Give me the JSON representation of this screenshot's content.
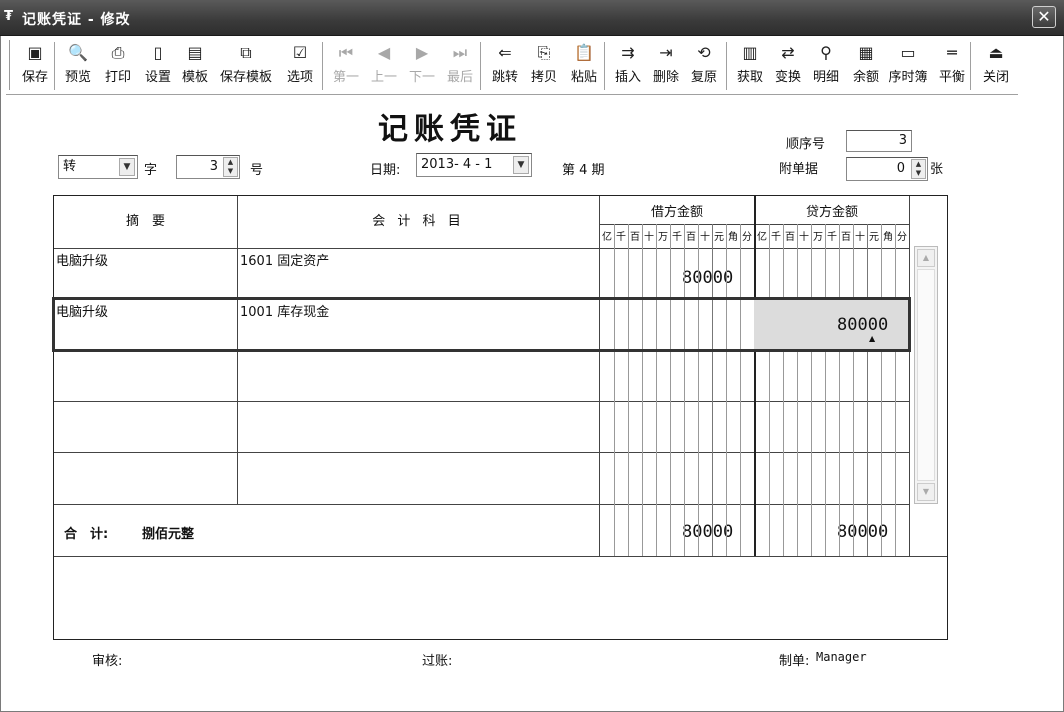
{
  "window": {
    "title": "记账凭证 - 修改",
    "close": "✕"
  },
  "toolbar": [
    {
      "label": "保存",
      "icon": "save-icon",
      "glyph": "▣",
      "enabled": true
    },
    {
      "label": "预览",
      "icon": "preview-icon",
      "glyph": "🔍",
      "enabled": true
    },
    {
      "label": "打印",
      "icon": "print-icon",
      "glyph": "⎙",
      "enabled": true
    },
    {
      "label": "设置",
      "icon": "page-setup-icon",
      "glyph": "▯",
      "enabled": true
    },
    {
      "label": "模板",
      "icon": "template-icon",
      "glyph": "▤",
      "enabled": true
    },
    {
      "label": "保存模板",
      "icon": "save-template-icon",
      "glyph": "⧉",
      "enabled": true
    },
    {
      "label": "选项",
      "icon": "options-icon",
      "glyph": "☑",
      "enabled": true
    },
    {
      "label": "第一",
      "icon": "first-icon",
      "glyph": "⏮",
      "enabled": false
    },
    {
      "label": "上一",
      "icon": "previous-icon",
      "glyph": "◀",
      "enabled": false
    },
    {
      "label": "下一",
      "icon": "next-icon",
      "glyph": "▶",
      "enabled": false
    },
    {
      "label": "最后",
      "icon": "last-icon",
      "glyph": "⏭",
      "enabled": false
    },
    {
      "label": "跳转",
      "icon": "jump-icon",
      "glyph": "⇐",
      "enabled": true
    },
    {
      "label": "拷贝",
      "icon": "copy-icon",
      "glyph": "⎘",
      "enabled": true
    },
    {
      "label": "粘贴",
      "icon": "paste-icon",
      "glyph": "📋",
      "enabled": true
    },
    {
      "label": "插入",
      "icon": "insert-row-icon",
      "glyph": "⇉",
      "enabled": true
    },
    {
      "label": "删除",
      "icon": "delete-row-icon",
      "glyph": "⇥",
      "enabled": true
    },
    {
      "label": "复原",
      "icon": "restore-icon",
      "glyph": "⟲",
      "enabled": true
    },
    {
      "label": "获取",
      "icon": "fetch-icon",
      "glyph": "▥",
      "enabled": true
    },
    {
      "label": "变换",
      "icon": "transform-icon",
      "glyph": "⇄",
      "enabled": true
    },
    {
      "label": "明细",
      "icon": "detail-icon",
      "glyph": "⚲",
      "enabled": true
    },
    {
      "label": "余额",
      "icon": "balance-icon",
      "glyph": "▦",
      "enabled": true
    },
    {
      "label": "序时簿",
      "icon": "journal-icon",
      "glyph": "▭",
      "enabled": true
    },
    {
      "label": "平衡",
      "icon": "balance-check-icon",
      "glyph": "═",
      "enabled": true
    },
    {
      "label": "关闭",
      "icon": "close-window-icon",
      "glyph": "⏏",
      "enabled": true
    }
  ],
  "voucher": {
    "title": "记账凭证",
    "seq_label": "顺序号",
    "seq_value": "3",
    "attach_label": "附单据",
    "attach_value": "0",
    "attach_unit": "张",
    "type_value": "转",
    "type_suffix": "字",
    "number_value": "3",
    "number_suffix": "号",
    "date_label": "日期:",
    "date_value": "2013- 4 - 1",
    "period": "第 4 期"
  },
  "table": {
    "headers": {
      "summary": "摘　要",
      "account": "会 计 科 目",
      "debit": "借方金额",
      "credit": "贷方金额"
    },
    "digit_units": [
      "亿",
      "千",
      "百",
      "十",
      "万",
      "千",
      "百",
      "十",
      "元",
      "角",
      "分"
    ],
    "rows": [
      {
        "summary": "电脑升级",
        "account": "1601 固定资产",
        "debit": "80000",
        "credit": ""
      },
      {
        "summary": "电脑升级",
        "account": "1001 库存现金",
        "debit": "",
        "credit": "80000"
      },
      {
        "summary": "",
        "account": "",
        "debit": "",
        "credit": ""
      },
      {
        "summary": "",
        "account": "",
        "debit": "",
        "credit": ""
      },
      {
        "summary": "",
        "account": "",
        "debit": "",
        "credit": ""
      }
    ],
    "total_label": "合　计:",
    "total_words": "捌佰元整",
    "total_debit": "80000",
    "total_credit": "80000"
  },
  "footer": {
    "reviewer_label": "审核:",
    "posting_label": "过账:",
    "maker_label": "制单:",
    "maker_value": "Manager"
  }
}
